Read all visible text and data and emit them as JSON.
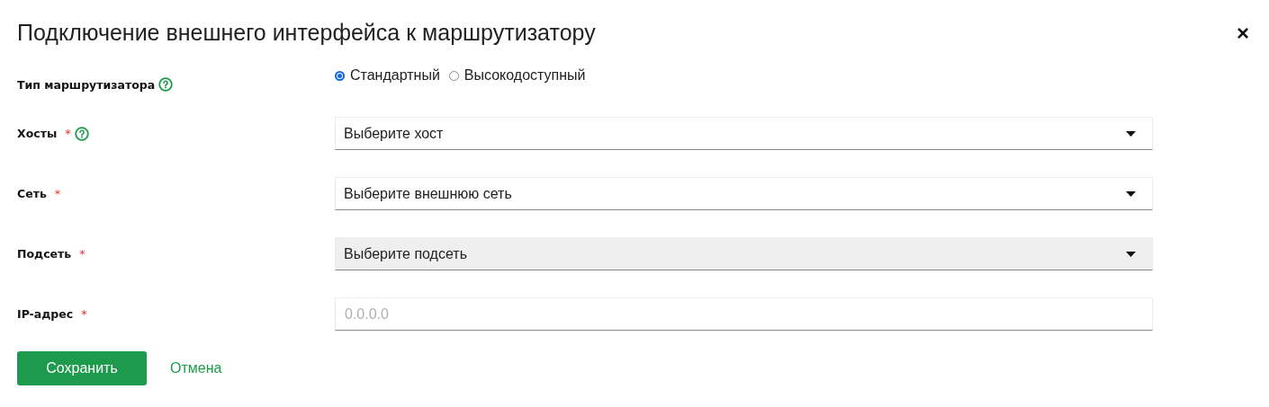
{
  "dialog": {
    "title": "Подключение внешнего интерфейса к маршрутизатору",
    "close": "×"
  },
  "fields": [
    {
      "kind": "radio",
      "label": "Тип маршрутизатора",
      "required": false,
      "help": true,
      "options": [
        {
          "label": "Стандартный",
          "selected": true
        },
        {
          "label": "Высокодоступный",
          "selected": false
        }
      ]
    },
    {
      "kind": "select",
      "label": "Хосты",
      "required": true,
      "help": true,
      "value": "Выберите хост",
      "disabled": false
    },
    {
      "kind": "select",
      "label": "Сеть",
      "required": true,
      "help": false,
      "value": "Выберите внешнюю сеть",
      "disabled": false
    },
    {
      "kind": "select",
      "label": "Подсеть",
      "required": true,
      "help": false,
      "value": "Выберите подсеть",
      "disabled": true
    },
    {
      "kind": "input",
      "label": "IP-адрес",
      "required": true,
      "help": false,
      "placeholder": "0.0.0.0"
    }
  ],
  "buttons": {
    "save": "Сохранить",
    "cancel": "Отмена"
  },
  "required_mark": "*"
}
